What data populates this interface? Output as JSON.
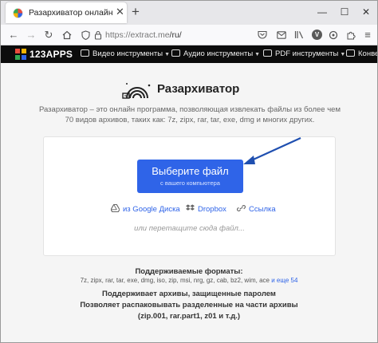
{
  "browser": {
    "tab_title": "Разархиватор онлайн",
    "tab_close": "✕",
    "new_tab": "+",
    "url_host": "https://extract.me",
    "url_path": "/ru/",
    "ext_badge": "V",
    "window_controls": {
      "minimize": "—",
      "maximize": "☐",
      "close": "✕"
    }
  },
  "site": {
    "logo_text": "123APPS",
    "menu": [
      {
        "label": "Видео инструменты",
        "icon": "video-icon"
      },
      {
        "label": "Аудио инструменты",
        "icon": "audio-icon"
      },
      {
        "label": "PDF инструменты",
        "icon": "pdf-icon"
      },
      {
        "label": "Конве",
        "icon": "convert-icon"
      }
    ]
  },
  "app": {
    "title": "Разархиватор",
    "description_line1": "Разархиватор – это онлайн программа, позволяющая извлекать файлы из более чем",
    "description_line2": "70 видов архивов, таких как: 7z, zipx, rar, tar, exe, dmg и многих других.",
    "choose_button": "Выберите файл",
    "choose_sub": "с вашего компьютера",
    "sources": [
      {
        "label": "из Google Диска",
        "icon": "google-drive-icon"
      },
      {
        "label": "Dropbox",
        "icon": "dropbox-icon"
      },
      {
        "label": "Ссылка",
        "icon": "link-icon"
      }
    ],
    "drop_hint": "или перетащите сюда файл..."
  },
  "info": {
    "formats_head": "Поддерживаемые форматы:",
    "formats_list": "7z, zipx, rar, tar, exe, dmg, iso, zip, msi, nrg, gz, cab, bz2, wim, ace",
    "formats_more": "и еще 54",
    "password_head": "Поддерживает архивы, защищенные паролем",
    "split_head": "Позволяет распаковывать разделенные на части архивы",
    "split_formats": "(zip.001, rar.part1, z01 и т.д.)"
  },
  "colors": {
    "accent": "#2f64e8",
    "header_bg": "#0c0c0c",
    "arrow": "#1f4fb0"
  }
}
